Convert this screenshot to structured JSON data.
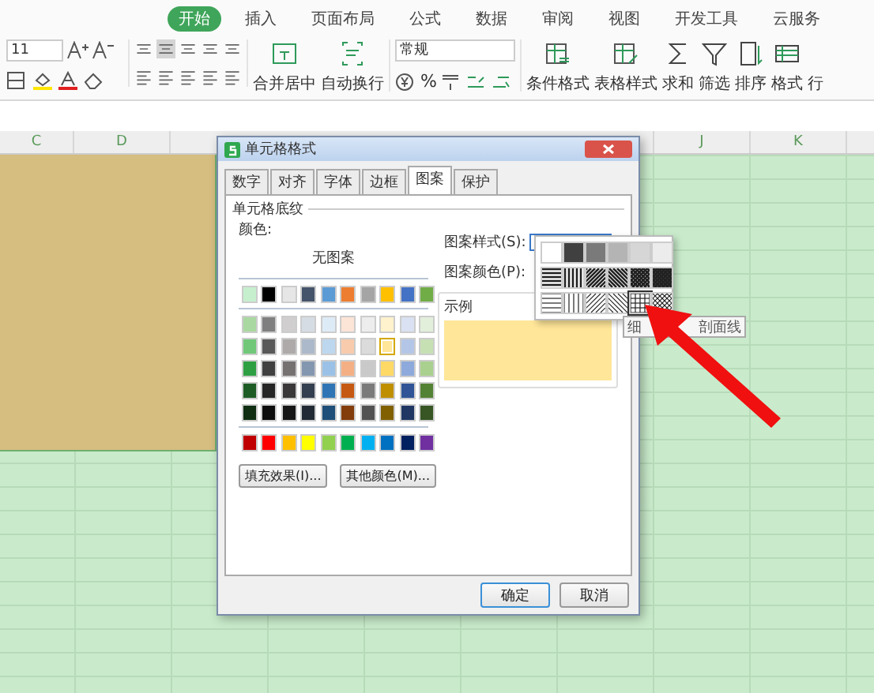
{
  "ribbon": {
    "tabs": [
      {
        "label": "开始",
        "selected": true
      },
      {
        "label": "插入",
        "selected": false
      },
      {
        "label": "页面布局",
        "selected": false
      },
      {
        "label": "公式",
        "selected": false
      },
      {
        "label": "数据",
        "selected": false
      },
      {
        "label": "审阅",
        "selected": false
      },
      {
        "label": "视图",
        "selected": false
      },
      {
        "label": "开发工具",
        "selected": false
      },
      {
        "label": "云服务",
        "selected": false
      }
    ],
    "font_size": "11",
    "number_format": "常规",
    "percent": "%",
    "merge_label": "合并居中",
    "wrap_label": "自动换行",
    "large_buttons": [
      {
        "kind": "cond",
        "label": "条件格式"
      },
      {
        "kind": "table",
        "label": "表格样式"
      },
      {
        "kind": "sum",
        "label": "求和"
      },
      {
        "kind": "filter",
        "label": "筛选"
      },
      {
        "kind": "sort",
        "label": "排序"
      },
      {
        "kind": "format",
        "label": "格式"
      },
      {
        "kind": "cut",
        "label": "行"
      }
    ]
  },
  "sheet": {
    "columns_left": [
      "C",
      "D"
    ],
    "columns_right": [
      "J",
      "K"
    ]
  },
  "dialog": {
    "title": "单元格格式",
    "tabs": [
      {
        "label": "数字",
        "selected": false
      },
      {
        "label": "对齐",
        "selected": false
      },
      {
        "label": "字体",
        "selected": false
      },
      {
        "label": "边框",
        "selected": false
      },
      {
        "label": "图案",
        "selected": true
      },
      {
        "label": "保护",
        "selected": false
      }
    ],
    "section": "单元格底纹",
    "color_label": "颜色:",
    "no_pattern": "无图案",
    "palette": {
      "theme_row": [
        {
          "color": "#c6efce",
          "selected": false
        },
        {
          "color": "#000000",
          "selected": false
        },
        {
          "color": "#e7e6e6",
          "selected": false
        },
        {
          "color": "#44546a",
          "selected": false
        },
        {
          "color": "#5b9bd5",
          "selected": false
        },
        {
          "color": "#ed7d31",
          "selected": false
        },
        {
          "color": "#a5a5a5",
          "selected": false
        },
        {
          "color": "#ffc000",
          "selected": false
        },
        {
          "color": "#4472c4",
          "selected": false
        },
        {
          "color": "#70ad47",
          "selected": false
        }
      ],
      "tint_rows": [
        [
          {
            "color": "#a9d8a0",
            "selected": false
          },
          {
            "color": "#7f7f7f",
            "selected": false
          },
          {
            "color": "#d0cece",
            "selected": false
          },
          {
            "color": "#d6dce4",
            "selected": false
          },
          {
            "color": "#ddebf7",
            "selected": false
          },
          {
            "color": "#fce4d6",
            "selected": false
          },
          {
            "color": "#ededed",
            "selected": false
          },
          {
            "color": "#fff2cc",
            "selected": false
          },
          {
            "color": "#d9e1f2",
            "selected": false
          },
          {
            "color": "#e2efda",
            "selected": false
          }
        ],
        [
          {
            "color": "#70c878",
            "selected": false
          },
          {
            "color": "#595959",
            "selected": false
          },
          {
            "color": "#aeaaaa",
            "selected": false
          },
          {
            "color": "#acb9ca",
            "selected": false
          },
          {
            "color": "#bdd7ee",
            "selected": false
          },
          {
            "color": "#f8cbad",
            "selected": false
          },
          {
            "color": "#dbdbdb",
            "selected": false
          },
          {
            "color": "#ffe699",
            "selected": true
          },
          {
            "color": "#b4c6e7",
            "selected": false
          },
          {
            "color": "#c6e0b4",
            "selected": false
          }
        ],
        [
          {
            "color": "#2ea043",
            "selected": false
          },
          {
            "color": "#404040",
            "selected": false
          },
          {
            "color": "#757171",
            "selected": false
          },
          {
            "color": "#8497b0",
            "selected": false
          },
          {
            "color": "#9bc2e6",
            "selected": false
          },
          {
            "color": "#f4b084",
            "selected": false
          },
          {
            "color": "#c9c9c9",
            "selected": false
          },
          {
            "color": "#ffd966",
            "selected": false
          },
          {
            "color": "#8ea9db",
            "selected": false
          },
          {
            "color": "#a9d08e",
            "selected": false
          }
        ],
        [
          {
            "color": "#1e5c25",
            "selected": false
          },
          {
            "color": "#262626",
            "selected": false
          },
          {
            "color": "#3a3838",
            "selected": false
          },
          {
            "color": "#333f4f",
            "selected": false
          },
          {
            "color": "#2f75b5",
            "selected": false
          },
          {
            "color": "#c65911",
            "selected": false
          },
          {
            "color": "#7b7b7b",
            "selected": false
          },
          {
            "color": "#bf8f00",
            "selected": false
          },
          {
            "color": "#305496",
            "selected": false
          },
          {
            "color": "#548235",
            "selected": false
          }
        ],
        [
          {
            "color": "#0f2e12",
            "selected": false
          },
          {
            "color": "#0d0d0d",
            "selected": false
          },
          {
            "color": "#161616",
            "selected": false
          },
          {
            "color": "#222b35",
            "selected": false
          },
          {
            "color": "#1f4e78",
            "selected": false
          },
          {
            "color": "#833c0c",
            "selected": false
          },
          {
            "color": "#525252",
            "selected": false
          },
          {
            "color": "#806000",
            "selected": false
          },
          {
            "color": "#203764",
            "selected": false
          },
          {
            "color": "#375623",
            "selected": false
          }
        ]
      ],
      "standard_row": [
        {
          "color": "#c00000",
          "selected": false
        },
        {
          "color": "#ff0000",
          "selected": false
        },
        {
          "color": "#ffc000",
          "selected": false
        },
        {
          "color": "#ffff00",
          "selected": false
        },
        {
          "color": "#92d050",
          "selected": false
        },
        {
          "color": "#00b050",
          "selected": false
        },
        {
          "color": "#00b0f0",
          "selected": false
        },
        {
          "color": "#0070c0",
          "selected": false
        },
        {
          "color": "#002060",
          "selected": false
        },
        {
          "color": "#7030a0",
          "selected": false
        }
      ]
    },
    "pattern_style_label": "图案样式(S):",
    "pattern_color_label": "图案颜色(P):",
    "sample_label": "示例",
    "pattern_popup": [
      {
        "kind": "white",
        "selected": false
      },
      {
        "kind": "gray75",
        "selected": false
      },
      {
        "kind": "gray50",
        "selected": false
      },
      {
        "kind": "gray25",
        "selected": false
      },
      {
        "kind": "gray12",
        "selected": false
      },
      {
        "kind": "gray6",
        "selected": false
      },
      {
        "kind": "h_thick",
        "selected": false
      },
      {
        "kind": "v_thick",
        "selected": false
      },
      {
        "kind": "d_thick",
        "selected": false
      },
      {
        "kind": "u_thick",
        "selected": false
      },
      {
        "kind": "x_thick",
        "selected": false
      },
      {
        "kind": "x_dense",
        "selected": false
      },
      {
        "kind": "h_thin",
        "selected": false
      },
      {
        "kind": "v_thin",
        "selected": false
      },
      {
        "kind": "d_thin",
        "selected": false
      },
      {
        "kind": "u_thin",
        "selected": false
      },
      {
        "kind": "grid_thin",
        "selected": true
      },
      {
        "kind": "x_thin",
        "selected": false
      }
    ],
    "tooltip": [
      "细",
      "剖面线"
    ],
    "fill_effects": "填充效果(I)...",
    "more_colors": "其他颜色(M)...",
    "ok": "确定",
    "cancel": "取消"
  }
}
